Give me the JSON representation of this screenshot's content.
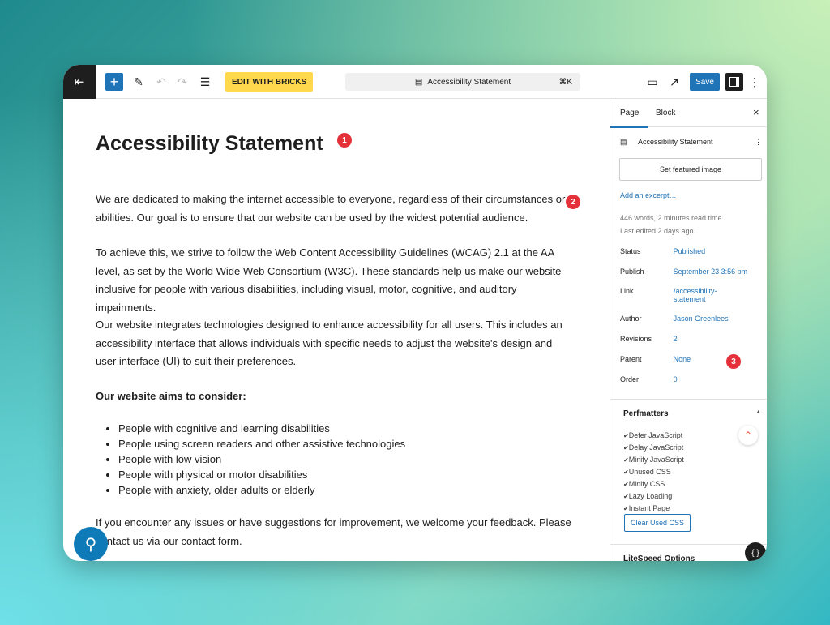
{
  "toolbar": {
    "edit_bricks": "EDIT WITH BRICKS",
    "command": "Accessibility Statement",
    "shortcut": "⌘K",
    "save": "Save"
  },
  "content": {
    "title": "Accessibility Statement",
    "paragraphs": [
      "We are dedicated to making the internet accessible to everyone, regardless of their circumstances or abilities. Our goal is to ensure that our website can be used by the widest potential audience.",
      "To achieve this, we strive to follow the Web Content Accessibility Guidelines (WCAG) 2.1 at the AA level, as set by the World Wide Web Consortium (W3C). These standards help us make our website inclusive for people with various disabilities, including visual, motor, cognitive, and auditory impairments.",
      "Our website integrates technologies designed to enhance accessibility for all users. This includes an accessibility interface that allows individuals with specific needs to adjust the website's design and user interface (UI) to suit their preferences.",
      "If you encounter any issues or have suggestions for improvement, we welcome your feedback. Please contact us via our contact form."
    ],
    "subheading": "Our website aims to consider:",
    "list": [
      "People with cognitive and learning disabilities",
      "People using screen readers and other assistive technologies",
      "People with low vision",
      "People with physical or motor disabilities",
      "People with anxiety, older adults or elderly"
    ]
  },
  "badges": [
    "1",
    "2",
    "3"
  ],
  "sidebar": {
    "tabs": [
      "Page",
      "Block"
    ],
    "doc_title": "Accessibility Statement",
    "featured": "Set featured image",
    "excerpt": "Add an excerpt…",
    "stats": "446 words, 2 minutes read time.",
    "edited": "Last edited 2 days ago.",
    "fields": [
      {
        "label": "Status",
        "value": "Published"
      },
      {
        "label": "Publish",
        "value": "September 23 3:56 pm"
      },
      {
        "label": "Link",
        "value": "/accessibility-statement"
      },
      {
        "label": "Author",
        "value": "Jason Greenlees"
      },
      {
        "label": "Revisions",
        "value": "2"
      },
      {
        "label": "Parent",
        "value": "None"
      },
      {
        "label": "Order",
        "value": "0"
      }
    ],
    "perfmatters": {
      "title": "Perfmatters",
      "items": [
        "Defer JavaScript",
        "Delay JavaScript",
        "Minify JavaScript",
        "Unused CSS",
        "Minify CSS",
        "Lazy Loading",
        "Instant Page"
      ],
      "clear": "Clear Used CSS"
    },
    "next_panel": "LiteSpeed Options"
  },
  "colors": {
    "accent": "#1f73b7",
    "bricks": "#ffd84d",
    "badge": "#e5323a"
  }
}
